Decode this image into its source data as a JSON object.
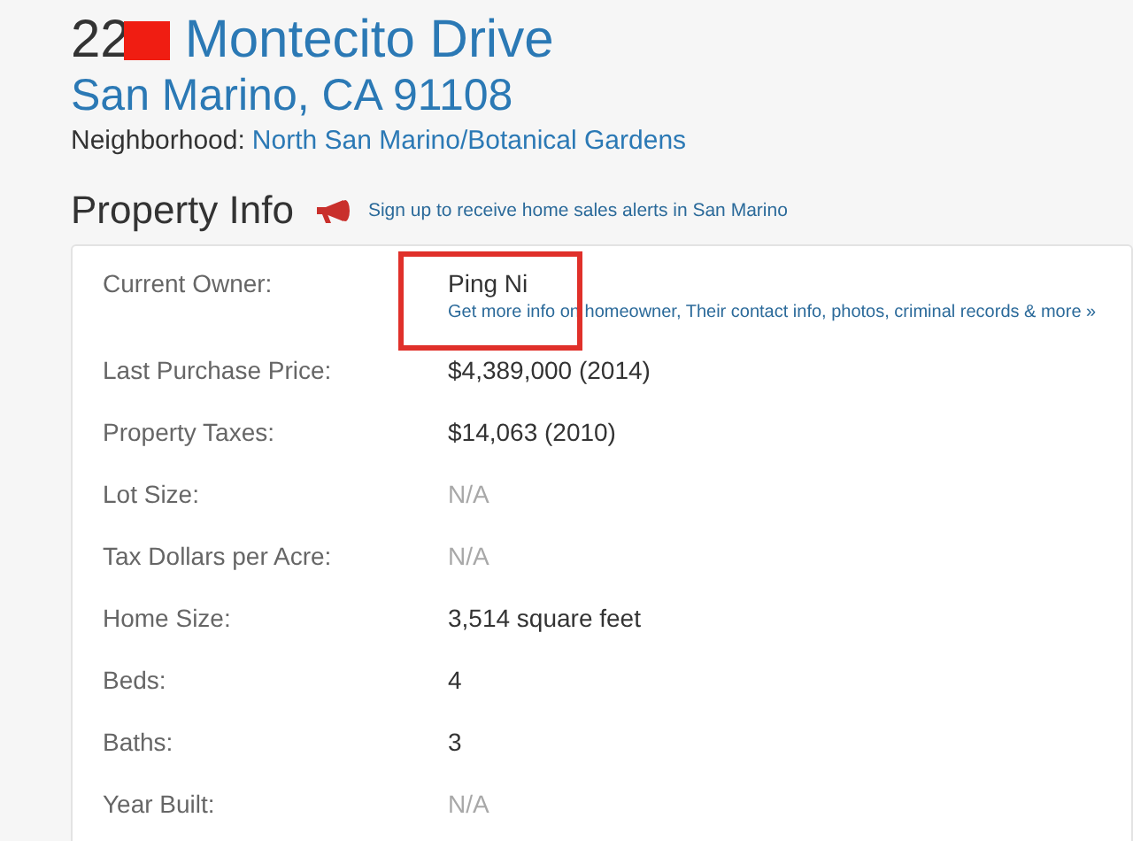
{
  "address": {
    "number_visible": "22",
    "redacted": true,
    "street": "Montecito Drive",
    "city_line": "San Marino, CA 91108",
    "neighborhood_label": "Neighborhood:",
    "neighborhood": "North San Marino/Botanical Gardens"
  },
  "section": {
    "title": "Property Info",
    "alert_link": "Sign up to receive home sales alerts in San Marino"
  },
  "rows": [
    {
      "label": "Current Owner:",
      "value": "Ping Ni",
      "muted": false,
      "highlighted": true,
      "link": "Get more info on homeowner, Their contact info, photos, criminal records & more »"
    },
    {
      "label": "Last Purchase Price:",
      "value": "$4,389,000 (2014)",
      "muted": false,
      "highlighted": false
    },
    {
      "label": "Property Taxes:",
      "value": "$14,063 (2010)",
      "muted": false,
      "highlighted": false
    },
    {
      "label": "Lot Size:",
      "value": "N/A",
      "muted": true,
      "highlighted": false
    },
    {
      "label": "Tax Dollars per Acre:",
      "value": "N/A",
      "muted": true,
      "highlighted": false
    },
    {
      "label": "Home Size:",
      "value": "3,514 square feet",
      "muted": false,
      "highlighted": false
    },
    {
      "label": "Beds:",
      "value": "4",
      "muted": false,
      "highlighted": false
    },
    {
      "label": "Baths:",
      "value": "3",
      "muted": false,
      "highlighted": false
    },
    {
      "label": "Year Built:",
      "value": "N/A",
      "muted": true,
      "highlighted": false
    }
  ]
}
